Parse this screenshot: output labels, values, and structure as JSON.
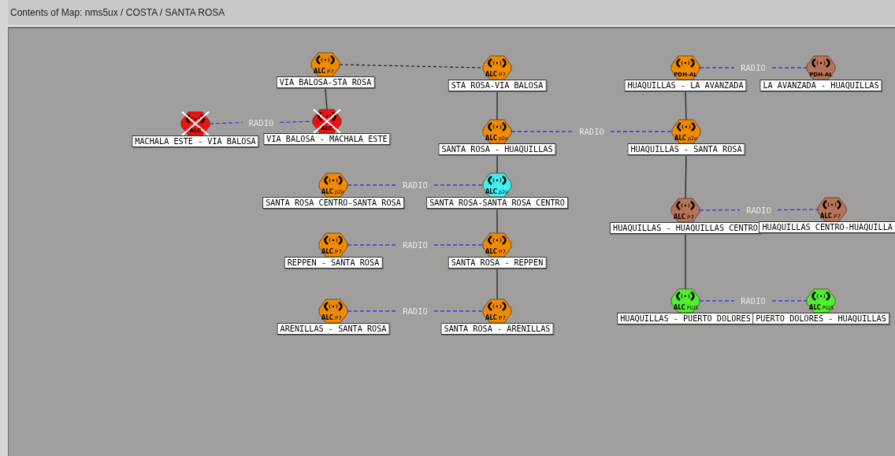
{
  "window": {
    "title": "Contents of Map: nms5ux / COSTA / SANTA ROSA"
  },
  "nodes": [
    {
      "label": "VIA BALOSA-STA ROSA",
      "color": "#f08a00",
      "badge": "ALC",
      "badge_sub": "P7",
      "failed": false
    },
    {
      "label": "STA ROSA-VIA BALOSA",
      "color": "#f08a00",
      "badge": "ALC",
      "badge_sub": "P7",
      "failed": false
    },
    {
      "label": "MACHALA ESTE - VIA BALOSA",
      "color": "#f01010",
      "badge": "ALC",
      "failed": true
    },
    {
      "label": "VIA BALOSA - MACHALA ESTE",
      "color": "#f01010",
      "badge": "ALC",
      "failed": true
    },
    {
      "label": "SANTA ROSA - HUAQUILLAS",
      "color": "#f08a00",
      "badge": "ALC",
      "badge_sub": "p2e",
      "failed": false
    },
    {
      "label": "HUAQUILLAS - LA AVANZADA",
      "color": "#f08a00",
      "badge": "PDH-AL",
      "failed": false
    },
    {
      "label": "LA AVANZADA - HUAQUILLAS",
      "color": "#b87358",
      "badge": "PDH-AL",
      "failed": false
    },
    {
      "label": "HUAQUILLAS - SANTA ROSA",
      "color": "#f08a00",
      "badge": "ALC",
      "badge_sub": "p2e",
      "failed": false
    },
    {
      "label": "SANTA ROSA CENTRO-SANTA ROSA",
      "color": "#f08a00",
      "badge": "ALC",
      "badge_sub": "p2e",
      "failed": false
    },
    {
      "label": "SANTA ROSA-SANTA ROSA CENTRO",
      "color": "#40f0f0",
      "badge": "ALC",
      "badge_sub": "p2e",
      "failed": false
    },
    {
      "label": "HUAQUILLAS - HUAQUILLAS CENTRO",
      "color": "#b87358",
      "badge": "ALC",
      "badge_sub": "P7",
      "failed": false
    },
    {
      "label": "HUAQUILLAS CENTRO-HUAQUILLA",
      "color": "#b87358",
      "badge": "ALC",
      "badge_sub": "P7",
      "failed": false
    },
    {
      "label": "REPPEN - SANTA ROSA",
      "color": "#f08a00",
      "badge": "ALC",
      "badge_sub": "P7",
      "failed": false
    },
    {
      "label": "SANTA ROSA - REPPEN",
      "color": "#f08a00",
      "badge": "ALC",
      "badge_sub": "P7",
      "failed": false
    },
    {
      "label": "HUAQUILLAS - PUERTO DOLORES",
      "color": "#50f030",
      "badge": "ALC",
      "badge_sub": "PLUS",
      "failed": false
    },
    {
      "label": "PUERTO DOLORES - HUAQUILLAS",
      "color": "#50f030",
      "badge": "ALC",
      "badge_sub": "PLUS",
      "failed": false
    },
    {
      "label": "ARENILLAS - SANTA ROSA",
      "color": "#f08a00",
      "badge": "ALC",
      "badge_sub": "P7",
      "failed": false
    },
    {
      "label": "SANTA ROSA - ARENILLAS",
      "color": "#f08a00",
      "badge": "ALC",
      "badge_sub": "P7",
      "failed": false
    }
  ],
  "links": [
    {
      "kind": "dashed"
    },
    {
      "kind": "wire"
    },
    {
      "kind": "radio",
      "label": "RADIO"
    },
    {
      "kind": "wire"
    },
    {
      "kind": "radio",
      "label": "RADIO"
    },
    {
      "kind": "radio",
      "label": "RADIO"
    },
    {
      "kind": "wire"
    },
    {
      "kind": "wire"
    },
    {
      "kind": "radio",
      "label": "RADIO"
    },
    {
      "kind": "wire"
    },
    {
      "kind": "radio",
      "label": "RADIO"
    },
    {
      "kind": "wire"
    },
    {
      "kind": "radio",
      "label": "RADIO"
    },
    {
      "kind": "wire"
    },
    {
      "kind": "radio",
      "label": "RADIO"
    },
    {
      "kind": "wire"
    },
    {
      "kind": "radio",
      "label": "RADIO"
    }
  ]
}
